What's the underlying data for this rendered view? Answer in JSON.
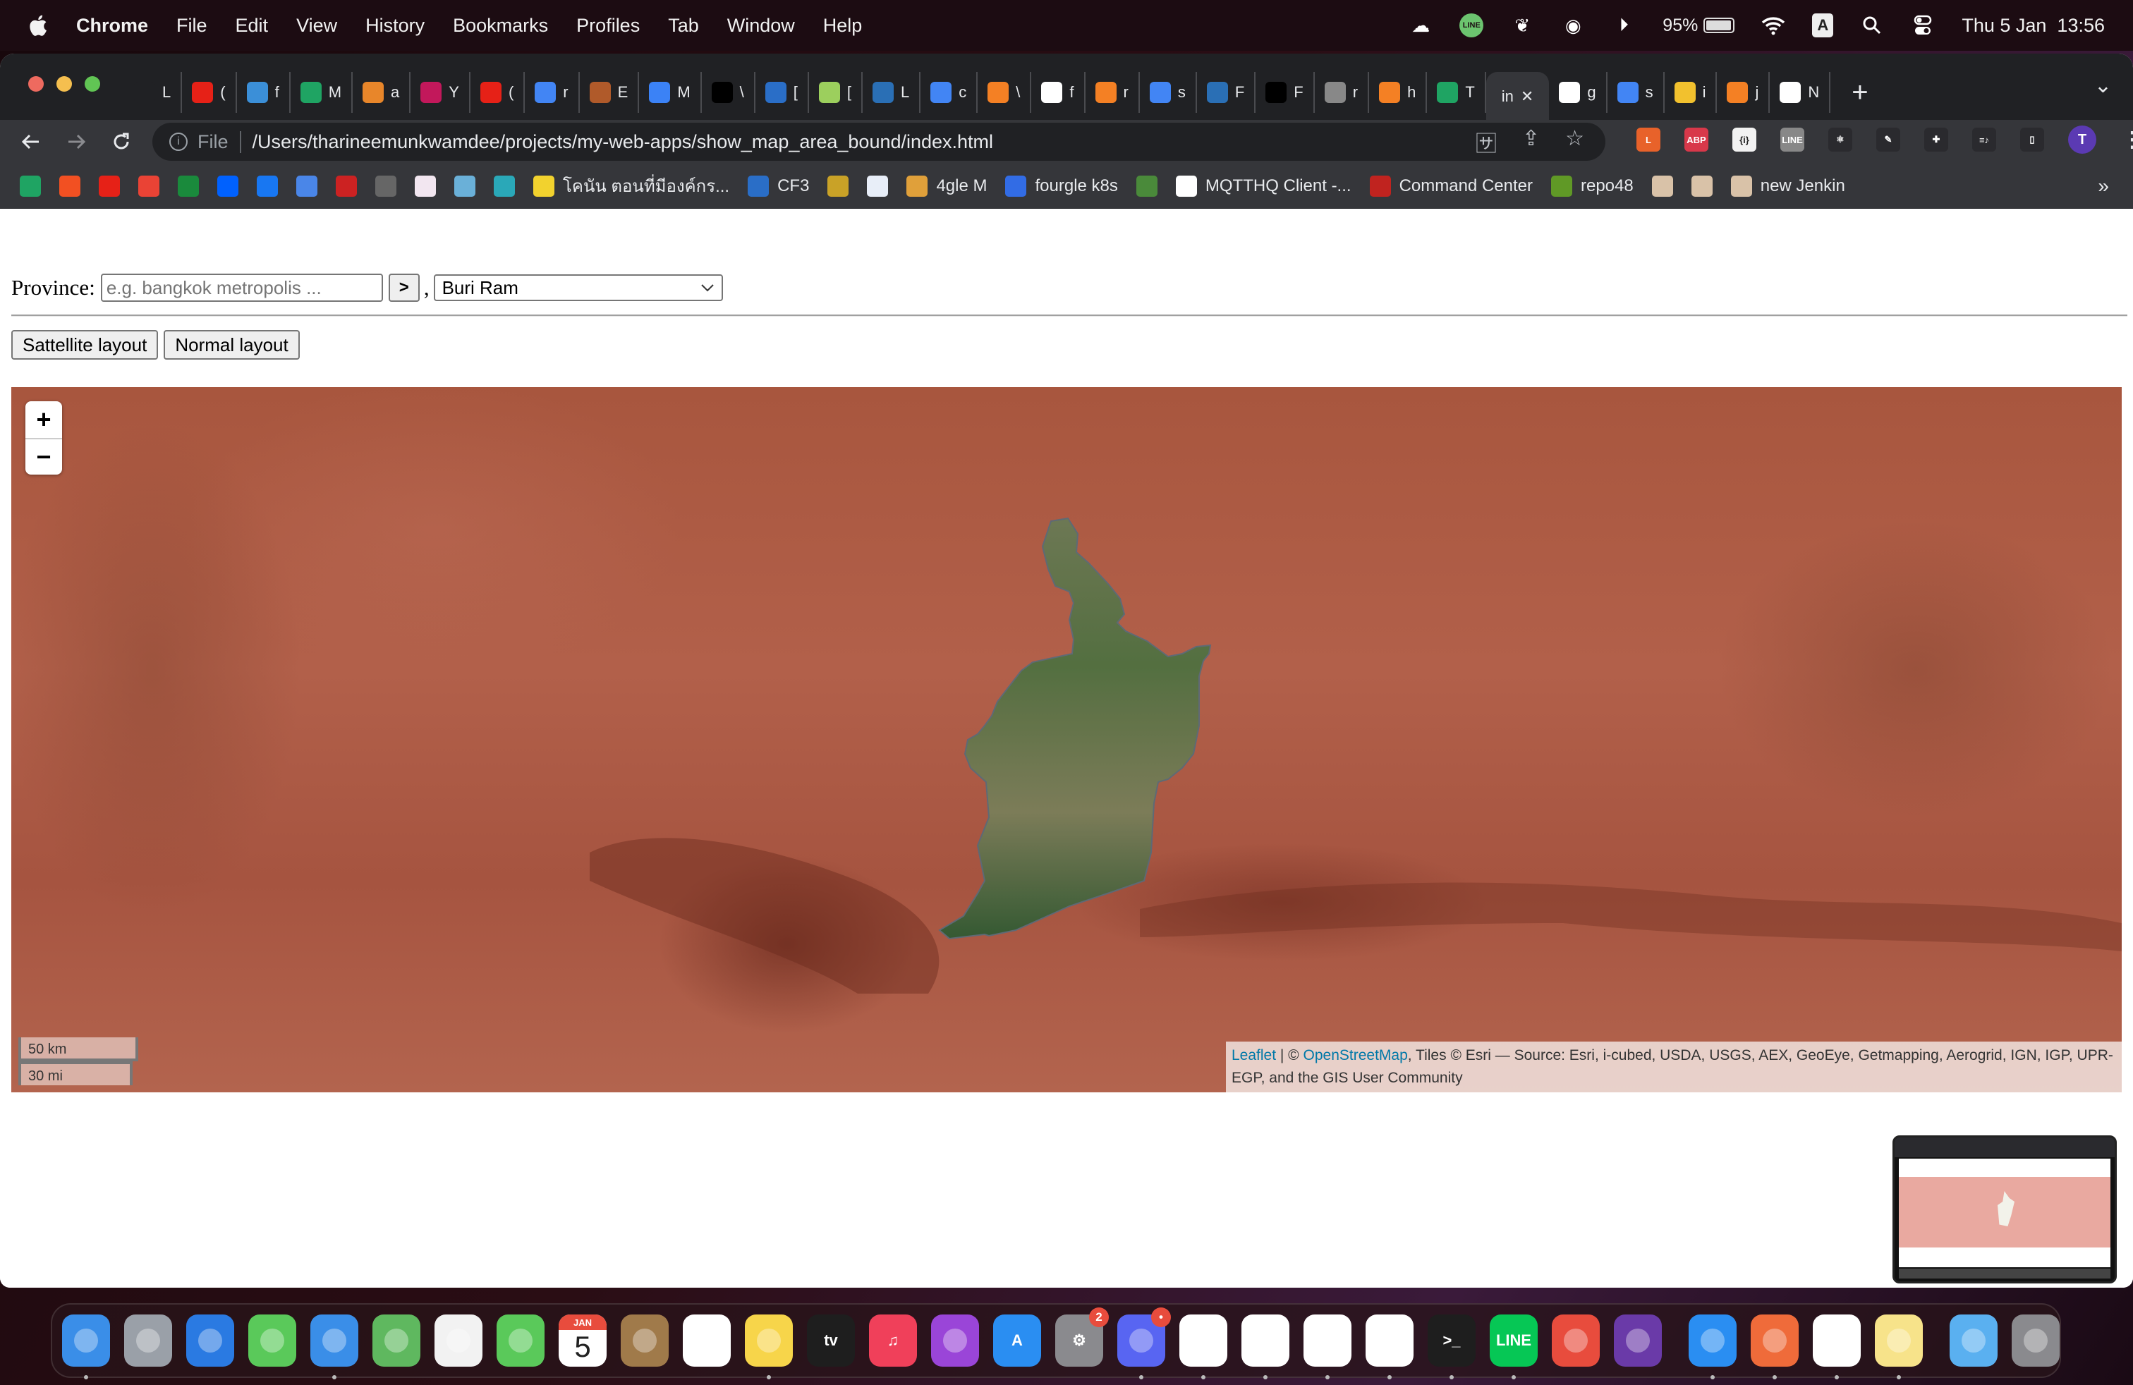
{
  "menubar": {
    "app_name": "Chrome",
    "items": [
      "File",
      "Edit",
      "View",
      "History",
      "Bookmarks",
      "Profiles",
      "Tab",
      "Window",
      "Help"
    ],
    "status": {
      "battery_percent": "95%",
      "battery_level": 0.95,
      "input_source": "A",
      "datetime": "Thu 5 Jan  13:56"
    }
  },
  "browser": {
    "tabs": [
      {
        "title": "L",
        "icon": "audio-icon",
        "color": "#202124"
      },
      {
        "title": "(",
        "icon": "youtube-icon",
        "color": "#e62117"
      },
      {
        "title": "f",
        "icon": "flutter-icon",
        "color": "#3b8fd8"
      },
      {
        "title": "M",
        "icon": "google-drive-icon",
        "color": "#1fa463"
      },
      {
        "title": "a",
        "icon": "drawio-icon",
        "color": "#e8862a"
      },
      {
        "title": "Y",
        "icon": "music-icon",
        "color": "#c2185b"
      },
      {
        "title": "(",
        "icon": "youtube-icon",
        "color": "#e62117"
      },
      {
        "title": "r",
        "icon": "google-icon",
        "color": "#4285f4"
      },
      {
        "title": "E",
        "icon": "game-icon",
        "color": "#b05a2a"
      },
      {
        "title": "M",
        "icon": "bilibili-icon",
        "color": "#3b82f6"
      },
      {
        "title": "\\",
        "icon": "appletv-icon",
        "color": "#000000"
      },
      {
        "title": "[",
        "icon": "cloud-icon",
        "color": "#2a6ec7"
      },
      {
        "title": "[",
        "icon": "mongodb-leaf-icon",
        "color": "#9ccf5d"
      },
      {
        "title": "L",
        "icon": "dart-icon",
        "color": "#2a6fb5"
      },
      {
        "title": "c",
        "icon": "google-icon",
        "color": "#4285f4"
      },
      {
        "title": "\\",
        "icon": "stackoverflow-icon",
        "color": "#f48024"
      },
      {
        "title": "f",
        "icon": "github-icon",
        "color": "#ffffff"
      },
      {
        "title": "r",
        "icon": "stackoverflow-icon",
        "color": "#f48024"
      },
      {
        "title": "s",
        "icon": "google-icon",
        "color": "#4285f4"
      },
      {
        "title": "F",
        "icon": "compass-icon",
        "color": "#2a6fb5"
      },
      {
        "title": "F",
        "icon": "oxa-icon",
        "color": "#000000"
      },
      {
        "title": "r",
        "icon": "globe-icon",
        "color": "#888888"
      },
      {
        "title": "h",
        "icon": "stackoverflow-icon",
        "color": "#f48024"
      },
      {
        "title": "T",
        "icon": "google-drive-icon",
        "color": "#1fa463"
      },
      {
        "title": "in",
        "icon": "",
        "color": "",
        "active": true
      },
      {
        "title": "g",
        "icon": "github-icon",
        "color": "#ffffff"
      },
      {
        "title": "s",
        "icon": "google-icon",
        "color": "#4285f4"
      },
      {
        "title": "i",
        "icon": "sketch-icon",
        "color": "#f2c12e"
      },
      {
        "title": "j",
        "icon": "stackoverflow-icon",
        "color": "#f48024"
      },
      {
        "title": "N",
        "icon": "chrome-icon",
        "color": "#ffffff"
      }
    ],
    "address": {
      "scheme_label": "File",
      "url": "/Users/tharineemunkwamdee/projects/my-web-apps/show_map_area_bound/index.html"
    },
    "extensions": [
      {
        "name": "longdo-dict-icon",
        "label": "L",
        "color": "#e8622a"
      },
      {
        "name": "adblock-plus-icon",
        "label": "ABP",
        "color": "#d8384a"
      },
      {
        "name": "json-viewer-icon",
        "label": "{i}",
        "color": "#f2f2f2"
      },
      {
        "name": "line-icon",
        "label": "LINE",
        "color": "#888888"
      },
      {
        "name": "react-devtools-icon",
        "label": "⚛",
        "color": "#2a2a2e"
      },
      {
        "name": "color-picker-icon",
        "label": "✎",
        "color": "#2a2a2e"
      },
      {
        "name": "extensions-puzzle-icon",
        "label": "✚",
        "color": "#2a2a2e"
      },
      {
        "name": "media-controls-icon",
        "label": "≡♪",
        "color": "#2a2a2e"
      },
      {
        "name": "side-panel-icon",
        "label": "▯",
        "color": "#2a2a2e"
      }
    ],
    "profile_initial": "T",
    "bookmarks": [
      {
        "label": "",
        "icon": "google-drive-icon",
        "color": "#1fa463"
      },
      {
        "label": "",
        "icon": "microsoft-icon",
        "color": "#f25022"
      },
      {
        "label": "",
        "icon": "youtube-icon",
        "color": "#e62117"
      },
      {
        "label": "",
        "icon": "gmail-icon",
        "color": "#ea4335"
      },
      {
        "label": "",
        "icon": "tv-icon",
        "color": "#1a8a3c"
      },
      {
        "label": "",
        "icon": "dropbox-icon",
        "color": "#0061fe"
      },
      {
        "label": "",
        "icon": "facebook-icon",
        "color": "#1877f2"
      },
      {
        "label": "",
        "icon": "inbox-icon",
        "color": "#4a86e8"
      },
      {
        "label": "",
        "icon": "bookmark-icon",
        "color": "#cc2222"
      },
      {
        "label": "",
        "icon": "film-icon",
        "color": "#666666"
      },
      {
        "label": "",
        "icon": "image-icon",
        "color": "#f2e6f0"
      },
      {
        "label": "",
        "icon": "bookmark-icon",
        "color": "#6ab0d8"
      },
      {
        "label": "",
        "icon": "n-icon",
        "color": "#2aa8b8"
      },
      {
        "label": "โคนัน ตอนที่มีองค์กร...",
        "icon": "smiley-icon",
        "color": "#f2d22e"
      },
      {
        "label": "CF3",
        "icon": "c-icon",
        "color": "#2a6ec7"
      },
      {
        "label": "",
        "icon": "m-coin-icon",
        "color": "#c9a227"
      },
      {
        "label": "",
        "icon": "chart-icon",
        "color": "#e8eef8"
      },
      {
        "label": "4gle M",
        "icon": "box-icon",
        "color": "#e0a03a"
      },
      {
        "label": "fourgle k8s",
        "icon": "kubernetes-icon",
        "color": "#326ce5"
      },
      {
        "label": "",
        "icon": "plant-icon",
        "color": "#4a8a3a"
      },
      {
        "label": "MQTTHQ Client -...",
        "icon": "chat-icon",
        "color": "#ffffff"
      },
      {
        "label": "Command Center",
        "icon": "cross-icon",
        "color": "#c0231f"
      },
      {
        "label": "repo48",
        "icon": "gitea-icon",
        "color": "#609926"
      },
      {
        "label": "",
        "icon": "jenkins-icon",
        "color": "#d9c2a8"
      },
      {
        "label": "",
        "icon": "jenkins-icon",
        "color": "#d9c2a8"
      },
      {
        "label": "new Jenkin",
        "icon": "jenkins-icon",
        "color": "#d9c2a8"
      }
    ],
    "bookmarks_overflow": "»"
  },
  "page": {
    "province_label": "Province:",
    "province_input": {
      "value": "",
      "placeholder": "e.g. bangkok metropolis ..."
    },
    "go_button": ">",
    "separator": ",",
    "province_select": {
      "selected": "Buri Ram"
    },
    "layout_buttons": [
      "Sattellite layout",
      "Normal layout"
    ],
    "map": {
      "zoom_in": "+",
      "zoom_out": "−",
      "highlighted_province": "Buri Ram",
      "highlight_color": "#3f6b3a",
      "scale_km": "50 km",
      "scale_mi": "30 mi",
      "attribution": {
        "leaflet": "Leaflet",
        "sep": " | © ",
        "osm": "OpenStreetMap",
        "rest": ", Tiles © Esri — Source: Esri, i-cubed, USDA, USGS, AEX, GeoEye, Getmapping, Aerogrid, IGN, IGP, UPR-EGP, and the GIS User Community"
      }
    }
  },
  "dock": {
    "apps": [
      {
        "name": "finder",
        "label": "",
        "color": "#3a8ee8",
        "running": true
      },
      {
        "name": "launchpad",
        "label": "",
        "color": "#9aa0a8"
      },
      {
        "name": "safari",
        "label": "",
        "color": "#2a7ae2"
      },
      {
        "name": "messages",
        "label": "",
        "color": "#5ac95a"
      },
      {
        "name": "mail",
        "label": "",
        "color": "#3a8ee8",
        "running": true
      },
      {
        "name": "maps",
        "label": "",
        "color": "#5fb85f"
      },
      {
        "name": "photos",
        "label": "",
        "color": "#f2f2f2"
      },
      {
        "name": "facetime",
        "label": "",
        "color": "#5ac95a"
      },
      {
        "name": "calendar",
        "label": "5",
        "month": "JAN",
        "color": "#ffffff"
      },
      {
        "name": "contacts",
        "label": "",
        "color": "#a07a4a"
      },
      {
        "name": "reminders",
        "label": "",
        "color": "#ffffff"
      },
      {
        "name": "notes",
        "label": "",
        "color": "#f7d54a",
        "running": true
      },
      {
        "name": "apple-tv",
        "label": "tv",
        "color": "#1e1e1e"
      },
      {
        "name": "music",
        "label": "♫",
        "color": "#f0405a"
      },
      {
        "name": "podcasts",
        "label": "",
        "color": "#9a45d8"
      },
      {
        "name": "app-store",
        "label": "A",
        "color": "#2a8ef2"
      },
      {
        "name": "system-settings",
        "label": "⚙",
        "color": "#8a8a8e",
        "badge": "2"
      },
      {
        "name": "discord",
        "label": "",
        "color": "#5865f2",
        "badge": "•",
        "running": true
      },
      {
        "name": "chrome",
        "label": "",
        "color": "#ffffff",
        "running": true
      },
      {
        "name": "tradingview",
        "label": "",
        "color": "#ffffff",
        "running": true
      },
      {
        "name": "openvpn",
        "label": "",
        "color": "#ffffff",
        "running": true
      },
      {
        "name": "vscode",
        "label": "",
        "color": "#ffffff",
        "running": true
      },
      {
        "name": "terminal",
        "label": ">_",
        "color": "#1e1e1e",
        "running": true
      },
      {
        "name": "line",
        "label": "LINE",
        "color": "#06c755",
        "running": true
      },
      {
        "name": "magnifier",
        "label": "",
        "color": "#e84c3d"
      },
      {
        "name": "tor",
        "label": "",
        "color": "#6a3aa8"
      },
      {
        "name": "xcode-instruments",
        "label": "",
        "color": "#2a8ef2",
        "running": true,
        "group": 2
      },
      {
        "name": "postman",
        "label": "",
        "color": "#ef6b3a",
        "running": true,
        "group": 2
      },
      {
        "name": "cloud-app",
        "label": "",
        "color": "#ffffff",
        "running": true,
        "group": 2
      },
      {
        "name": "stickies",
        "label": "",
        "color": "#f7e38a",
        "running": true,
        "group": 2
      },
      {
        "name": "downloads-folder",
        "label": "",
        "color": "#5ab0f0",
        "group": 3
      },
      {
        "name": "trash",
        "label": "",
        "color": "#8a8a8e",
        "group": 3
      }
    ]
  }
}
